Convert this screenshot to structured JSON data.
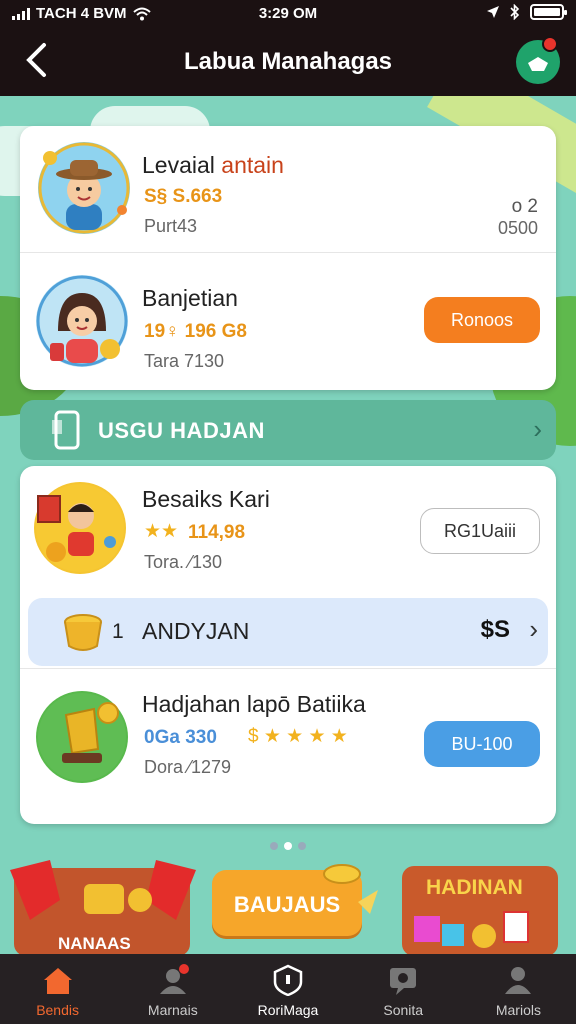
{
  "status": {
    "carrier": "TACH 4 BVM",
    "time": "3:29 OM"
  },
  "header": {
    "title": "Labua Manahagas"
  },
  "colors": {
    "bar": "#1b1112",
    "accent_orange": "#f47e1f",
    "accent_blue": "#4a9ee5",
    "teal": "#7fd3bd",
    "active_tab": "#f2682f"
  },
  "card_top": {
    "rows": [
      {
        "name_a": "Levaial ",
        "name_b": "antain",
        "score": "S§ S.663",
        "sub": "Purt43",
        "side_top": "o 2",
        "side_bottom": "0500"
      },
      {
        "name": "Banjetian",
        "score": "19♀ 196 G8",
        "sub": "Tara 7130",
        "button": "Ronoos"
      }
    ]
  },
  "banner": {
    "label": "USGU HADJAN",
    "icon": "phone-icon"
  },
  "card_bottom": {
    "row1": {
      "name": "Besaiks Kari",
      "score": "114,98",
      "sub": "Tora. ⁄130",
      "button": "RG1Uaiii"
    },
    "sub_row": {
      "index": "1",
      "label": "ANDYJAN",
      "value": "$S"
    },
    "row3": {
      "name": "Hadjahan lapō Batiika",
      "score": "0Ga 330",
      "stars": "$ ★ ★ ★ ★",
      "sub": "Dora ⁄1279",
      "button": "BU-100"
    }
  },
  "promos": {
    "left_text": "NANAAS",
    "center_button": "BAUJAUS",
    "right_text": "HADINAN"
  },
  "tabs": [
    {
      "label": "Bendis",
      "icon": "home-icon",
      "active": true
    },
    {
      "label": "Marnais",
      "icon": "profile-badge-icon",
      "active": false
    },
    {
      "label": "RoriMaga",
      "icon": "shield-icon",
      "active": false
    },
    {
      "label": "Sonita",
      "icon": "chat-icon",
      "active": false
    },
    {
      "label": "Mariols",
      "icon": "user-icon",
      "active": false
    }
  ]
}
